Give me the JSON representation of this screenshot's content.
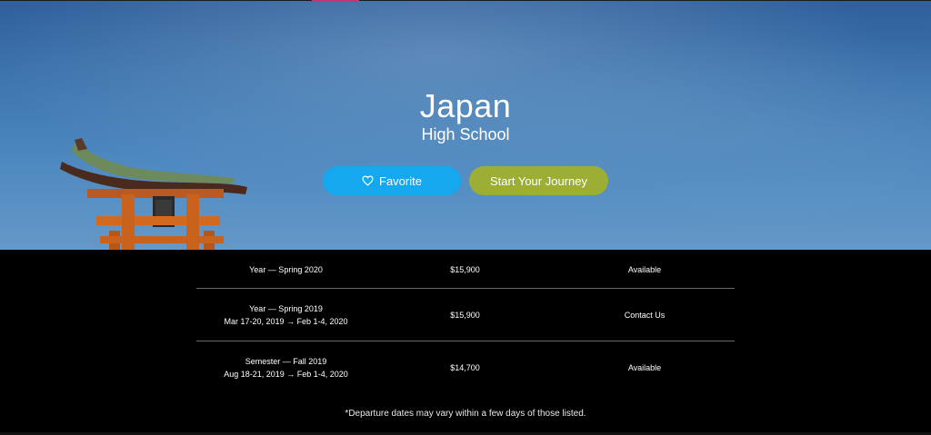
{
  "hero": {
    "title": "Japan",
    "subtitle": "High School",
    "favorite_label": "Favorite",
    "journey_label": "Start Your Journey",
    "colors": {
      "favorite_button": "#15a8ee",
      "journey_button": "#9cae34",
      "accent": "#c0357d"
    }
  },
  "programs": [
    {
      "term": "Year — Spring 2020",
      "dates": "",
      "price": "$15,900",
      "status": "Available"
    },
    {
      "term": "Year — Spring 2019",
      "dates": "Mar 17-20, 2019 → Feb 1-4, 2020",
      "price": "$15,900",
      "status": "Contact Us"
    },
    {
      "term": "Semester — Fall 2019",
      "dates": "Aug 18-21, 2019 → Feb 1-4, 2020",
      "price": "$14,700",
      "status": "Available"
    }
  ],
  "footnote": "*Departure dates may vary within a few days of those listed.",
  "icons": {
    "favorite": "heart-outline-icon"
  }
}
